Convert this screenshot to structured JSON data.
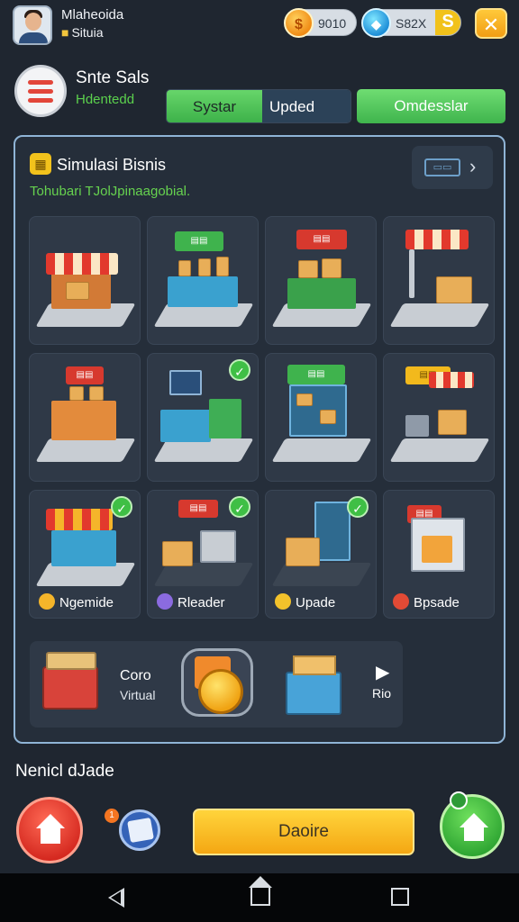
{
  "user": {
    "name": "Mlaheoida",
    "status": "Situia"
  },
  "currency": {
    "coins": "9010",
    "gems": "S82X",
    "coin_icon": "coin-icon",
    "gem_icon": "gem-icon",
    "add_label": "S"
  },
  "close_icon_glyph": "✕",
  "header": {
    "title": "Snte Sals",
    "subtitle": "Hdentedd",
    "tab_system": "Systar",
    "tab_update": "Upded",
    "tab_omni": "Omdesslar"
  },
  "panel": {
    "title": "Simulasi Bisnis",
    "subtitle": "Tohubari TJolJpinaagobial.",
    "link_icon": "ticket-icon",
    "tiles": [
      {
        "checked": false,
        "label": "",
        "label_color": ""
      },
      {
        "checked": false,
        "label": "",
        "label_color": ""
      },
      {
        "checked": false,
        "label": "",
        "label_color": ""
      },
      {
        "checked": false,
        "label": "",
        "label_color": ""
      },
      {
        "checked": false,
        "label": "",
        "label_color": ""
      },
      {
        "checked": true,
        "label": "",
        "label_color": ""
      },
      {
        "checked": false,
        "label": "",
        "label_color": ""
      },
      {
        "checked": false,
        "label": "",
        "label_color": ""
      },
      {
        "checked": true,
        "label": "Ngemide",
        "label_color": "#f5b52a"
      },
      {
        "checked": true,
        "label": "Rleader",
        "label_color": "#8b6be0"
      },
      {
        "checked": true,
        "label": "Upade",
        "label_color": "#f3c22b"
      },
      {
        "checked": false,
        "label": "Bpsade",
        "label_color": "#e24a35"
      }
    ],
    "strip": {
      "item_title": "Coro",
      "item_sub": "Virtual",
      "more_label": "Rio"
    }
  },
  "footer": {
    "title": "Nenicl dJade",
    "action_label": "Daoire",
    "badge_count": "1"
  },
  "colors": {
    "accent_green": "#3bb048",
    "accent_yellow": "#f4a713",
    "accent_red": "#d4281f",
    "panel_border": "#8fb4d6"
  }
}
